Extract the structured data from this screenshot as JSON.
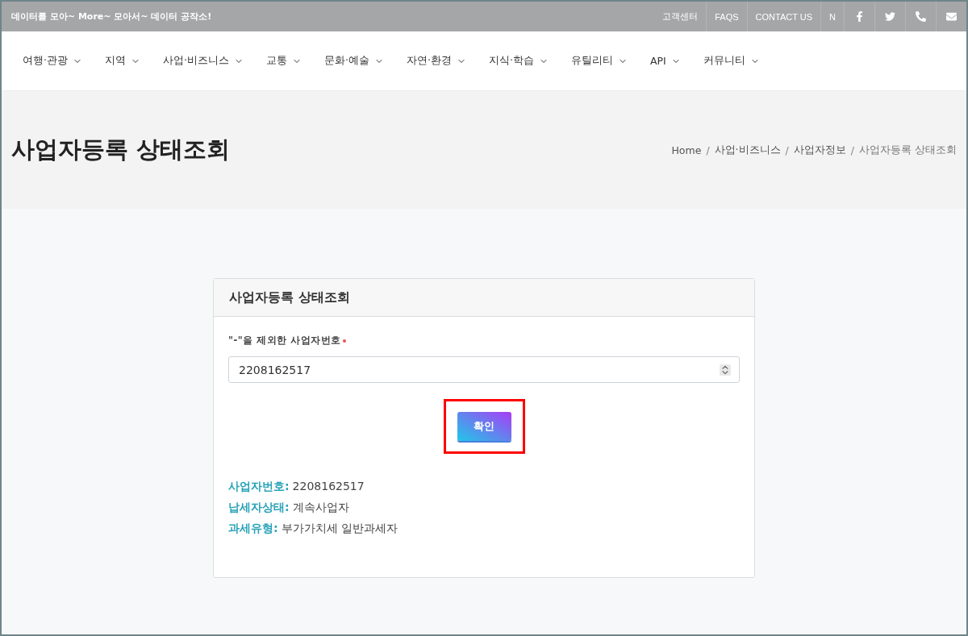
{
  "topbar": {
    "slogan": "데이터를 모아~ More~ 모아서~ 데이터 공작소!",
    "links": [
      "고객센터",
      "FAQS",
      "CONTACT US",
      "N"
    ],
    "icons": [
      {
        "kind": "facebook"
      },
      {
        "kind": "twitter"
      },
      {
        "kind": "phone"
      },
      {
        "kind": "mail"
      }
    ]
  },
  "nav": {
    "items": [
      "여행·관광",
      "지역",
      "사업·비즈니스",
      "교통",
      "문화·예술",
      "자연·환경",
      "지식·학습",
      "유틸리티",
      "API",
      "커뮤니티"
    ]
  },
  "page_header": {
    "title": "사업자등록 상태조회",
    "breadcrumb_separator": "/",
    "breadcrumb": [
      "Home",
      "사업·비즈니스",
      "사업자정보",
      "사업자등록 상태조회"
    ]
  },
  "card": {
    "title": "사업자등록 상태조회",
    "field": {
      "label": "\"-\"을 제외한 사업자번호",
      "required": true,
      "value": "2208162517"
    },
    "button": {
      "label": "확인",
      "highlighted": true
    },
    "results": [
      {
        "label": "사업자번호:",
        "value": "2208162517"
      },
      {
        "label": "납세자상태:",
        "value": "계속사업자"
      },
      {
        "label": "과세유형:",
        "value": "부가가치세 일반과세자"
      }
    ]
  }
}
